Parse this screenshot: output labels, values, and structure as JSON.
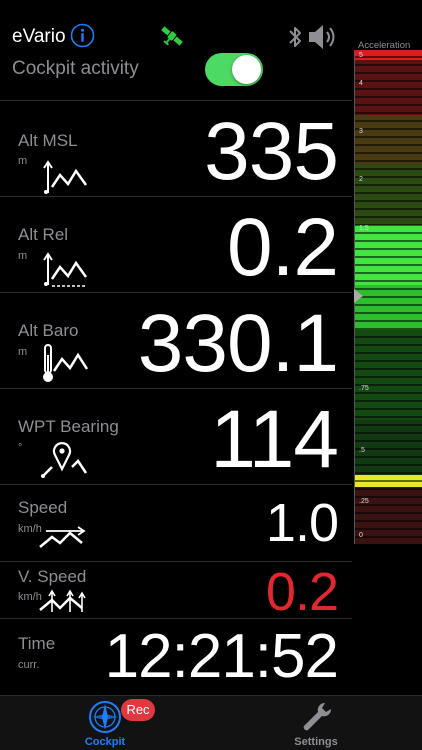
{
  "header": {
    "app_title": "eVario",
    "cockpit_label": "Cockpit activity",
    "cockpit_activity_on": true,
    "toggle_color": "#4cd964",
    "satellite_color": "#2ecc40"
  },
  "rows": [
    {
      "label": "Alt MSL",
      "unit": "m",
      "value": "335",
      "value_color": "#ffffff"
    },
    {
      "label": "Alt Rel",
      "unit": "m",
      "value": "0.2",
      "value_color": "#ffffff"
    },
    {
      "label": "Alt Baro",
      "unit": "m",
      "value": "330.1",
      "value_color": "#ffffff"
    },
    {
      "label": "WPT Bearing",
      "unit": "°",
      "value": "114",
      "value_color": "#ffffff"
    },
    {
      "label": "Speed",
      "unit": "km/h",
      "value": "1.0",
      "value_color": "#ffffff"
    },
    {
      "label": "V. Speed",
      "unit": "km/h",
      "value": "0.2",
      "value_color": "#e0282e"
    },
    {
      "label": "Time",
      "unit": "curr.",
      "value": "12:21:52",
      "value_color": "#ffffff"
    }
  ],
  "vario": {
    "title": "Acceleration",
    "tick_labels": [
      "5",
      "4",
      "3",
      "2",
      "1.5",
      ".75",
      ".5",
      ".25",
      "0"
    ]
  },
  "tabs": {
    "cockpit_label": "Cockpit",
    "settings_label": "Settings",
    "rec_badge": "Rec",
    "active_color": "#1e7ef7",
    "inactive_color": "#8e8e93"
  }
}
